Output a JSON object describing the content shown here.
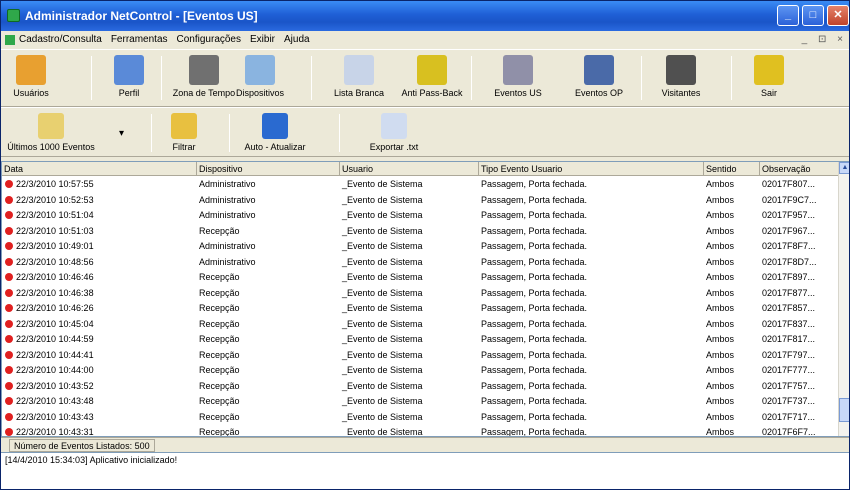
{
  "window": {
    "title": "Administrador NetControl - [Eventos US]"
  },
  "menu": [
    "Cadastro/Consulta",
    "Ferramentas",
    "Configurações",
    "Exibir",
    "Ajuda"
  ],
  "mdi_controls": "_ ⊡ ×",
  "toolbar1": [
    {
      "label": "Usuários",
      "icon": "users-icon",
      "color": "#e8a030"
    },
    {
      "label": "Perfil",
      "icon": "profile-icon",
      "color": "#5a8ad8"
    },
    {
      "label": "Zona de Tempo",
      "icon": "clock-icon",
      "color": "#707070"
    },
    {
      "label": "Dispositivos",
      "icon": "device-icon",
      "color": "#8ab4e0"
    },
    {
      "label": "Lista Branca",
      "icon": "whitelist-icon",
      "color": "#c8d4e8"
    },
    {
      "label": "Anti Pass-Back",
      "icon": "antipassback-icon",
      "color": "#d8c020"
    },
    {
      "label": "Eventos US",
      "icon": "events-us-icon",
      "color": "#9090a8"
    },
    {
      "label": "Eventos OP",
      "icon": "events-op-icon",
      "color": "#4a6aa8"
    },
    {
      "label": "Visitantes",
      "icon": "visitors-icon",
      "color": "#505050"
    },
    {
      "label": "Sair",
      "icon": "exit-door-icon",
      "color": "#e0c020"
    }
  ],
  "toolbar2": [
    {
      "label": "Últimos 1000 Eventos",
      "icon": "folder-open-icon",
      "color": "#e8d070"
    },
    {
      "label": "Filtrar",
      "icon": "filter-icon",
      "color": "#e8c040"
    },
    {
      "label": "Auto - Atualizar",
      "icon": "refresh-icon",
      "color": "#2a6ad0"
    },
    {
      "label": "Exportar .txt",
      "icon": "export-txt-icon",
      "color": "#d0dcf0"
    }
  ],
  "table": {
    "columns": [
      "Data",
      "Dispositivo",
      "Usuario",
      "Tipo Evento Usuario",
      "Sentido",
      "Observação"
    ],
    "rows": [
      [
        "22/3/2010 10:57:55",
        "Administrativo",
        "_Evento de Sistema",
        "Passagem, Porta fechada.",
        "Ambos",
        "02017F807..."
      ],
      [
        "22/3/2010 10:52:53",
        "Administrativo",
        "_Evento de Sistema",
        "Passagem, Porta fechada.",
        "Ambos",
        "02017F9C7..."
      ],
      [
        "22/3/2010 10:51:04",
        "Administrativo",
        "_Evento de Sistema",
        "Passagem, Porta fechada.",
        "Ambos",
        "02017F957..."
      ],
      [
        "22/3/2010 10:51:03",
        "Recepção",
        "_Evento de Sistema",
        "Passagem, Porta fechada.",
        "Ambos",
        "02017F967..."
      ],
      [
        "22/3/2010 10:49:01",
        "Administrativo",
        "_Evento de Sistema",
        "Passagem, Porta fechada.",
        "Ambos",
        "02017F8F7..."
      ],
      [
        "22/3/2010 10:48:56",
        "Administrativo",
        "_Evento de Sistema",
        "Passagem, Porta fechada.",
        "Ambos",
        "02017F8D7..."
      ],
      [
        "22/3/2010 10:46:46",
        "Recepção",
        "_Evento de Sistema",
        "Passagem, Porta fechada.",
        "Ambos",
        "02017F897..."
      ],
      [
        "22/3/2010 10:46:38",
        "Recepção",
        "_Evento de Sistema",
        "Passagem, Porta fechada.",
        "Ambos",
        "02017F877..."
      ],
      [
        "22/3/2010 10:46:26",
        "Recepção",
        "_Evento de Sistema",
        "Passagem, Porta fechada.",
        "Ambos",
        "02017F857..."
      ],
      [
        "22/3/2010 10:45:04",
        "Recepção",
        "_Evento de Sistema",
        "Passagem, Porta fechada.",
        "Ambos",
        "02017F837..."
      ],
      [
        "22/3/2010 10:44:59",
        "Recepção",
        "_Evento de Sistema",
        "Passagem, Porta fechada.",
        "Ambos",
        "02017F817..."
      ],
      [
        "22/3/2010 10:44:41",
        "Recepção",
        "_Evento de Sistema",
        "Passagem, Porta fechada.",
        "Ambos",
        "02017F797..."
      ],
      [
        "22/3/2010 10:44:00",
        "Recepção",
        "_Evento de Sistema",
        "Passagem, Porta fechada.",
        "Ambos",
        "02017F777..."
      ],
      [
        "22/3/2010 10:43:52",
        "Recepção",
        "_Evento de Sistema",
        "Passagem, Porta fechada.",
        "Ambos",
        "02017F757..."
      ],
      [
        "22/3/2010 10:43:48",
        "Recepção",
        "_Evento de Sistema",
        "Passagem, Porta fechada.",
        "Ambos",
        "02017F737..."
      ],
      [
        "22/3/2010 10:43:43",
        "Recepção",
        "_Evento de Sistema",
        "Passagem, Porta fechada.",
        "Ambos",
        "02017F717..."
      ],
      [
        "22/3/2010 10:43:31",
        "Recepção",
        "_Evento de Sistema",
        "Passagem, Porta fechada.",
        "Ambos",
        "02017F6F7..."
      ]
    ]
  },
  "status": {
    "events_listed": "Número de Eventos Listados:  500"
  },
  "log": {
    "line": "[14/4/2010 15:34:03] Aplicativo inicializado!"
  }
}
